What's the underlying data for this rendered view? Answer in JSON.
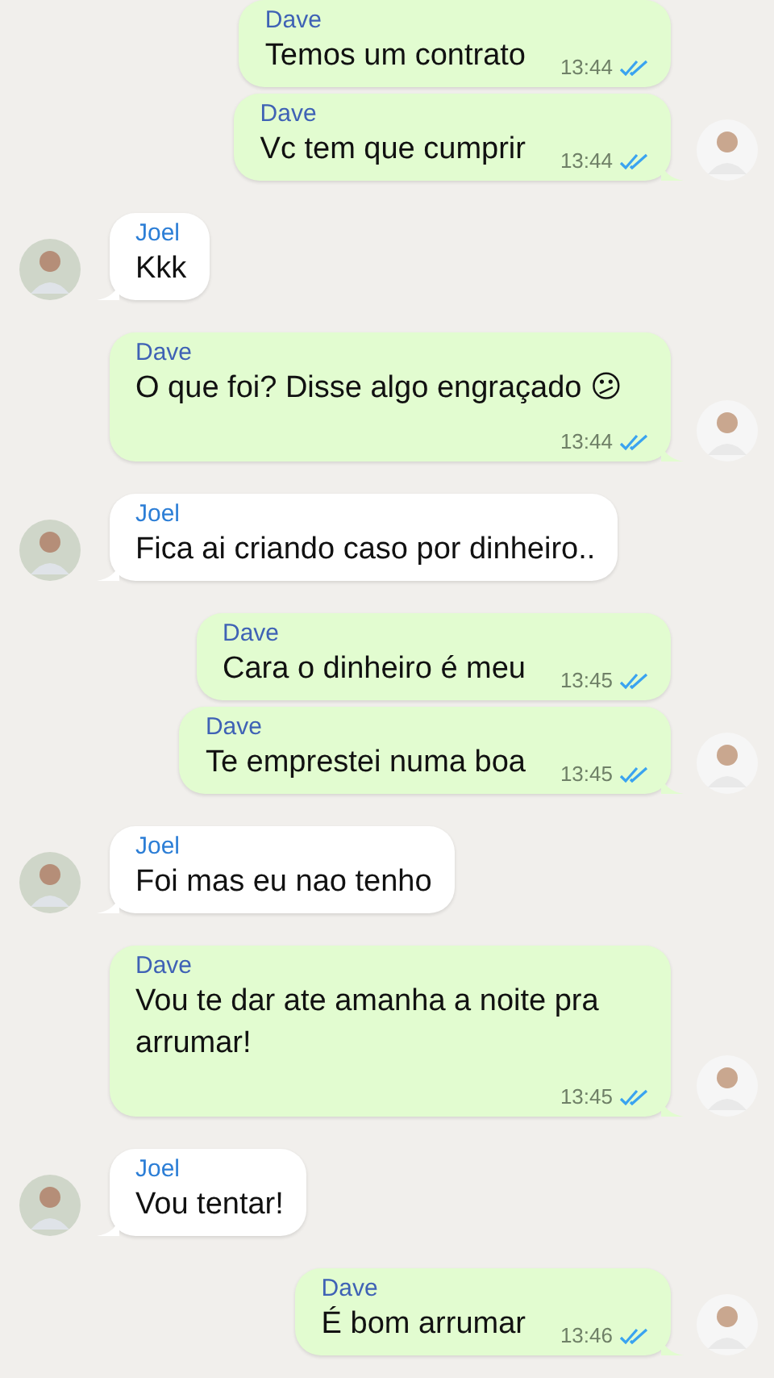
{
  "messages": [
    {
      "kind": "out",
      "sender": "Dave",
      "text": "Temos um contrato",
      "time": "13:44",
      "read": true,
      "avatar": false
    },
    {
      "kind": "out",
      "sender": "Dave",
      "text": "Vc tem que cumprir",
      "time": "13:44",
      "read": true,
      "avatar": true
    },
    {
      "kind": "in",
      "sender": "Joel",
      "text": "Kkk",
      "avatar": true
    },
    {
      "kind": "out",
      "sender": "Dave",
      "text": "O que foi? Disse algo engraçado 😕",
      "time": "13:44",
      "read": true,
      "avatar": true
    },
    {
      "kind": "in",
      "sender": "Joel",
      "text": "Fica ai criando caso por dinheiro..",
      "avatar": true
    },
    {
      "kind": "out",
      "sender": "Dave",
      "text": "Cara o dinheiro é meu",
      "time": "13:45",
      "read": true,
      "avatar": false
    },
    {
      "kind": "out",
      "sender": "Dave",
      "text": "Te emprestei numa boa",
      "time": "13:45",
      "read": true,
      "avatar": true
    },
    {
      "kind": "in",
      "sender": "Joel",
      "text": "Foi mas eu nao tenho",
      "avatar": true
    },
    {
      "kind": "out",
      "sender": "Dave",
      "text": "Vou te dar ate amanha a noite pra arrumar!",
      "time": "13:45",
      "read": true,
      "avatar": true
    },
    {
      "kind": "in",
      "sender": "Joel",
      "text": "Vou tentar!",
      "avatar": true
    },
    {
      "kind": "out",
      "sender": "Dave",
      "text": "É bom arrumar",
      "time": "13:46",
      "read": true,
      "avatar": true
    }
  ]
}
